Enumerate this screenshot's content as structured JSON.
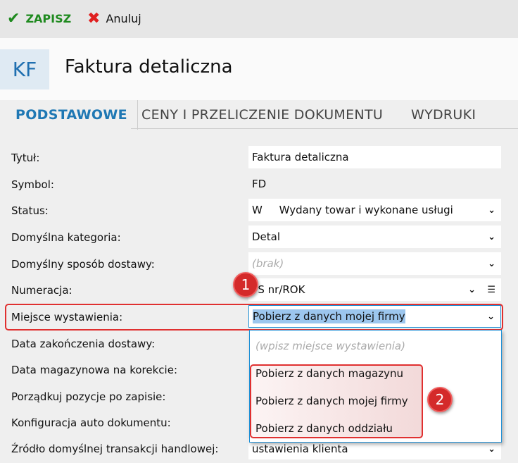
{
  "toolbar": {
    "save": "ZAPISZ",
    "cancel": "Anuluj",
    "save_color": "#1f8a1f",
    "cancel_color": "#e02020"
  },
  "header": {
    "badge": "KF",
    "title": "Faktura detaliczna"
  },
  "tabs": [
    "PODSTAWOWE",
    "CENY I PRZELICZENIE DOKUMENTU",
    "WYDRUKI"
  ],
  "fields": [
    {
      "label": "Tytuł:",
      "value": "Faktura detaliczna"
    },
    {
      "label": "Symbol:",
      "value": "FD"
    },
    {
      "label": "Status:",
      "value": "W     Wydany towar i wykonane usługi"
    },
    {
      "label": "Domyślna kategoria:",
      "value": "Detal"
    },
    {
      "label": "Domyślny sposób dostawy:",
      "value": "(brak)"
    },
    {
      "label": "Numeracja:",
      "value": "FS nr/ROK"
    },
    {
      "label": "Miejsce wystawienia:",
      "value": "Pobierz z danych mojej firmy"
    },
    {
      "label": "Data zakończenia dostawy:"
    },
    {
      "label": "Data magazynowa na korekcie:"
    },
    {
      "label": "Porządkuj pozycje po zapisie:"
    },
    {
      "label": "Konfiguracja auto dokumentu:"
    },
    {
      "label": "Źródło domyślnej transakcji handlowej:",
      "value": "ustawienia klienta"
    }
  ],
  "dropdown": {
    "placeholder": "(wpisz miejsce wystawienia)",
    "options": [
      "Pobierz z danych magazynu",
      "Pobierz z danych mojej firmy",
      "Pobierz z danych oddziału"
    ]
  },
  "annotations": [
    "1",
    "2"
  ]
}
